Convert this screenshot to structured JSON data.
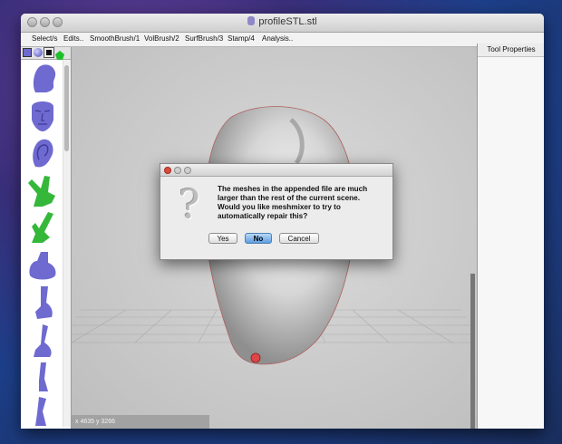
{
  "window": {
    "title": "profileSTL.stl"
  },
  "menu": [
    {
      "label": "Select/s"
    },
    {
      "label": "Edits.."
    },
    {
      "label": "SmoothBrush/1"
    },
    {
      "label": "VolBrush/2"
    },
    {
      "label": "SurfBrush/3"
    },
    {
      "label": "Stamp/4"
    },
    {
      "label": "Analysis.."
    }
  ],
  "tool_panel": {
    "title": "Tool Properties"
  },
  "status": {
    "coords": "x 4635 y 3266"
  },
  "dialog": {
    "message_lines": [
      "The meshes in the appended file are much",
      "larger than the rest of the current scene.",
      "Would you like meshmixer to try to",
      "automatically repair this?"
    ],
    "buttons": [
      {
        "label": "Yes",
        "default": false
      },
      {
        "label": "No",
        "default": true
      },
      {
        "label": "Cancel",
        "default": false
      }
    ]
  },
  "colors": {
    "mesh_accent": "#8e88c8",
    "thumb_blue": "#6e6ad0",
    "thumb_green": "#35b83a",
    "default_button": "#5d9ee2"
  },
  "icons": [
    "question-icon",
    "close-light",
    "minimize-light",
    "zoom-light"
  ]
}
